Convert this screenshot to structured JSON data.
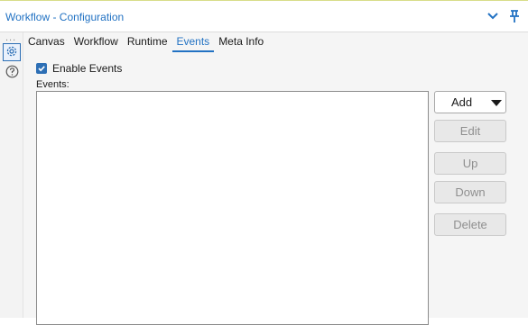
{
  "window": {
    "title": "Workflow - Configuration"
  },
  "icons": {
    "collapse": "chevron-down-icon",
    "pin": "pin-icon",
    "more": "more-dots-icon",
    "settings": "gear-icon",
    "help": "help-icon"
  },
  "sidebar": {
    "dots": "..."
  },
  "tabs": [
    {
      "label": "Canvas"
    },
    {
      "label": "Workflow"
    },
    {
      "label": "Runtime"
    },
    {
      "label": "Events",
      "active": true
    },
    {
      "label": "Meta Info"
    }
  ],
  "events": {
    "enable_label": "Enable Events",
    "enabled": true,
    "list_label": "Events:",
    "items": []
  },
  "buttons": {
    "add": "Add",
    "edit": "Edit",
    "up": "Up",
    "down": "Down",
    "delete": "Delete"
  },
  "colors": {
    "accent": "#2272c3",
    "checkbox": "#2d6fb5",
    "panel_bg": "#f5f5f5",
    "disabled_text": "#8f8f8f"
  }
}
